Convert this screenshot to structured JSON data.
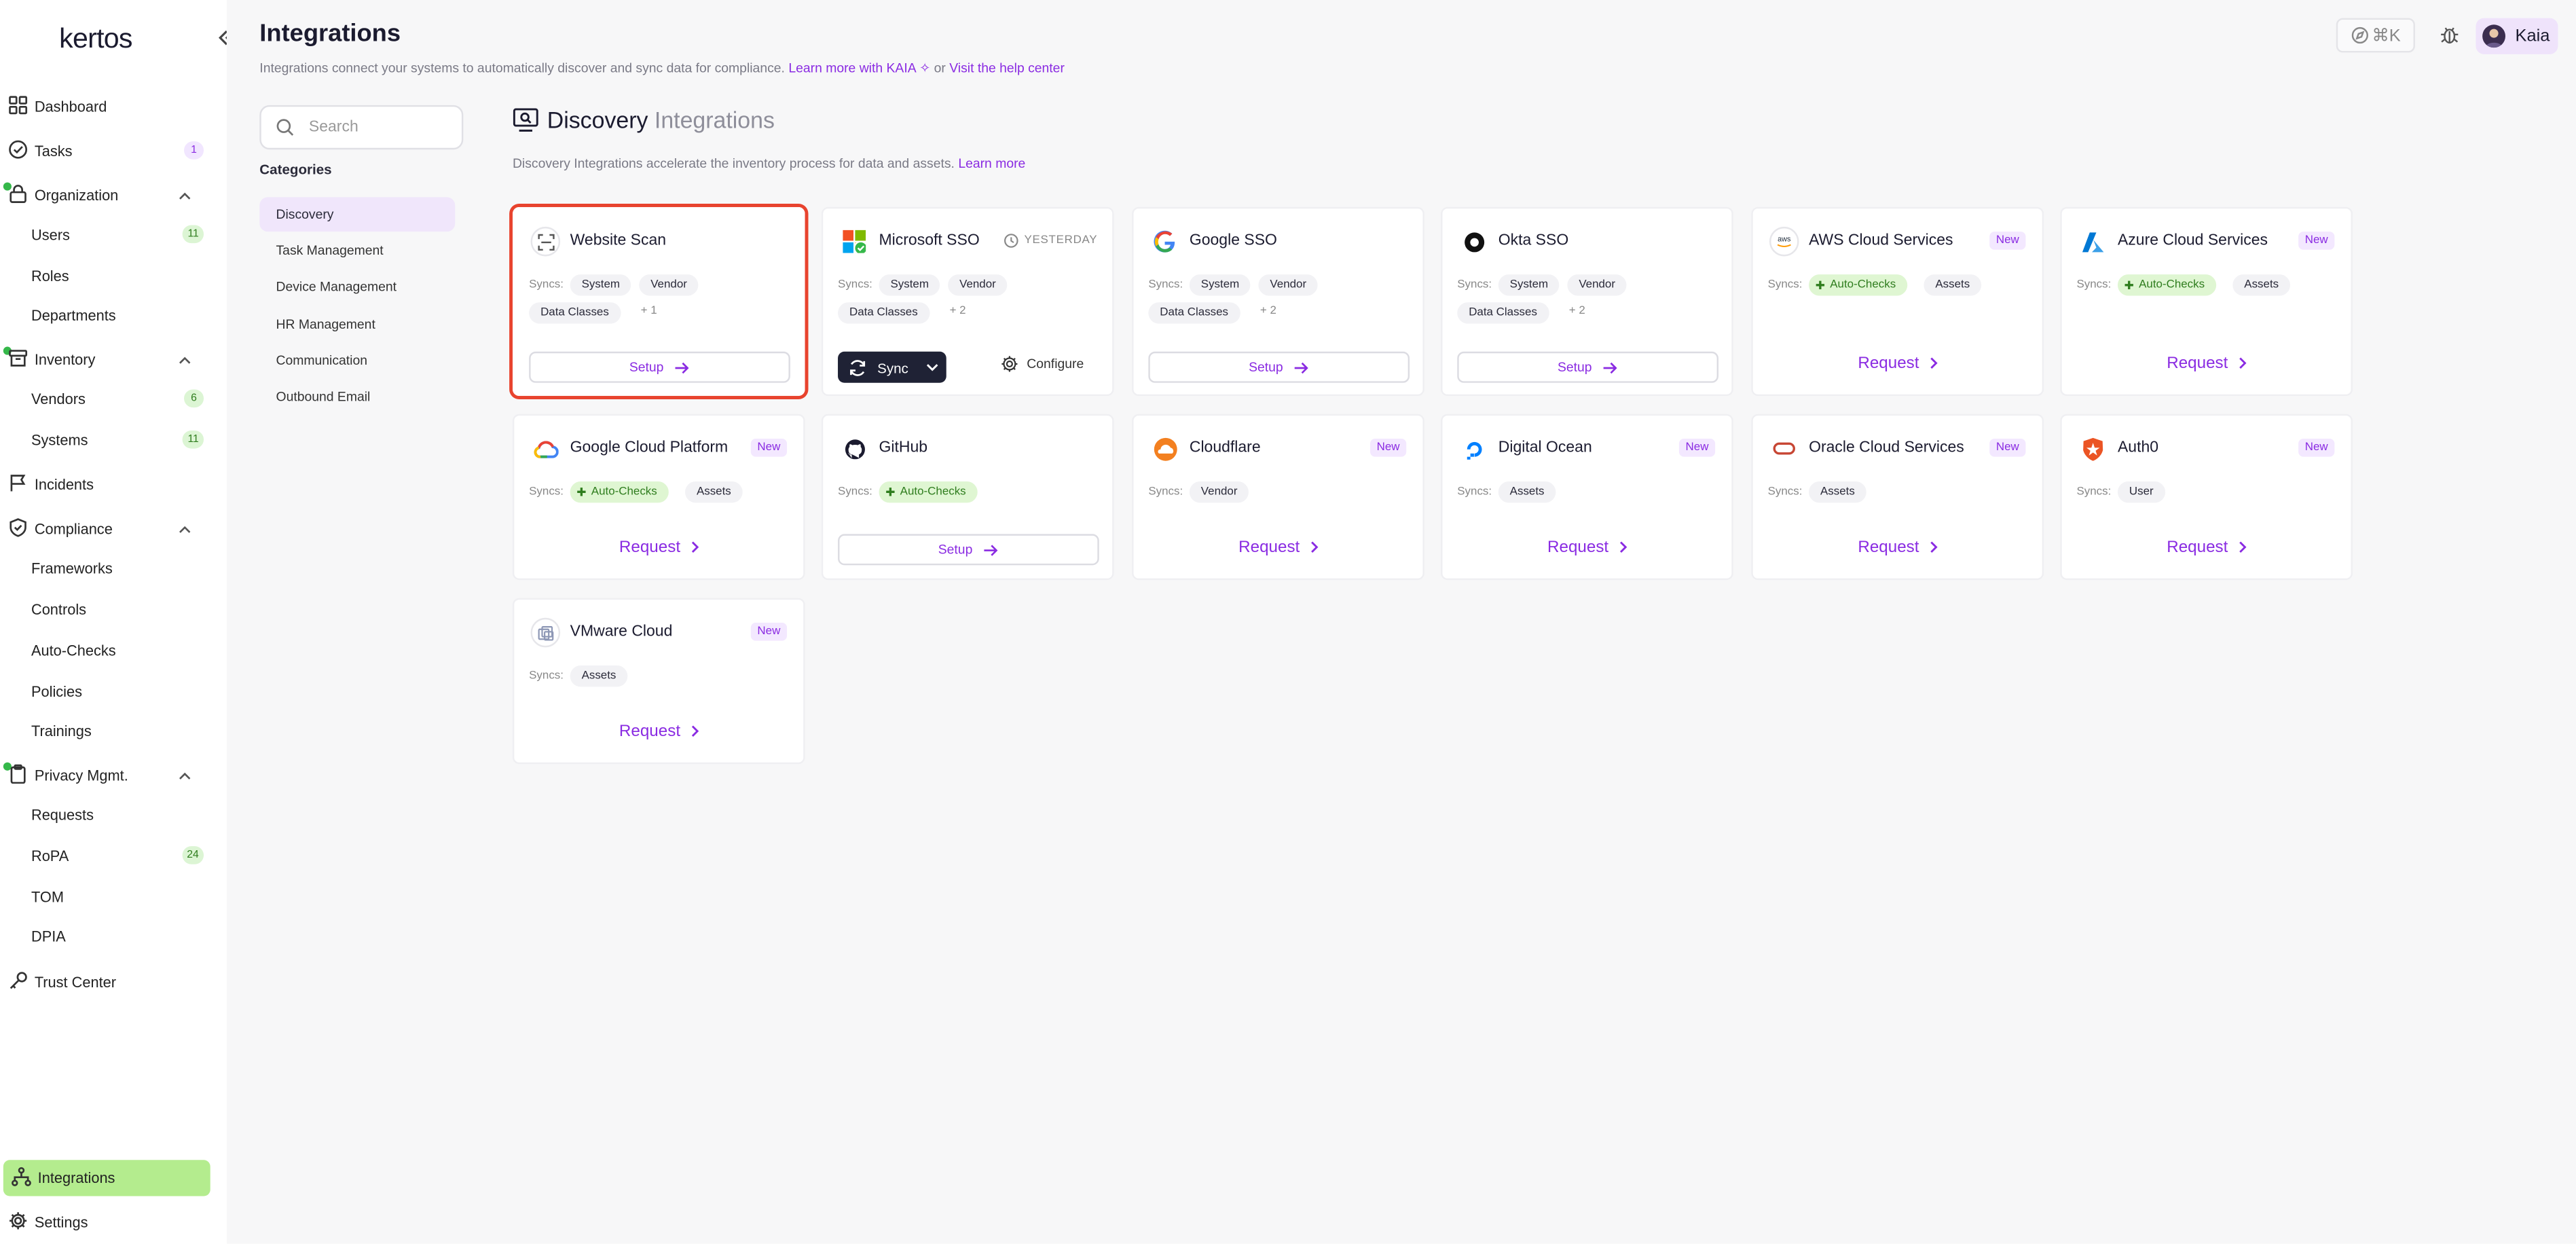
{
  "app": {
    "logo": "kertos"
  },
  "sidebar": {
    "items": [
      {
        "label": "Dashboard",
        "icon": "grid-icon"
      },
      {
        "label": "Tasks",
        "icon": "check-circle-icon",
        "badge": "1"
      },
      {
        "label": "Organization",
        "icon": "lock-icon"
      },
      {
        "label": "Users",
        "badge": "11"
      },
      {
        "label": "Roles"
      },
      {
        "label": "Departments"
      },
      {
        "label": "Inventory",
        "icon": "archive-icon"
      },
      {
        "label": "Vendors",
        "badge": "6"
      },
      {
        "label": "Systems",
        "badge": "11"
      },
      {
        "label": "Incidents",
        "icon": "flag-icon"
      },
      {
        "label": "Compliance",
        "icon": "shield-icon"
      },
      {
        "label": "Frameworks"
      },
      {
        "label": "Controls"
      },
      {
        "label": "Auto-Checks"
      },
      {
        "label": "Policies"
      },
      {
        "label": "Trainings"
      },
      {
        "label": "Privacy Mgmt.",
        "icon": "clipboard-icon"
      },
      {
        "label": "Requests"
      },
      {
        "label": "RoPA",
        "badge": "24"
      },
      {
        "label": "TOM"
      },
      {
        "label": "DPIA"
      },
      {
        "label": "Trust Center",
        "icon": "key-icon"
      },
      {
        "label": "Integrations",
        "icon": "integrations-icon",
        "active": true
      },
      {
        "label": "Settings",
        "icon": "gear-icon"
      }
    ]
  },
  "header": {
    "title": "Integrations",
    "subtitle": "Integrations connect your systems to automatically discover and sync data for compliance.",
    "learn_more": "Learn more with KAIA",
    "or": "or",
    "help": "Visit the help center",
    "shortcut": "⌘K",
    "user": "Kaia"
  },
  "filters": {
    "search_placeholder": "Search",
    "categories_title": "Categories",
    "categories": [
      "Discovery",
      "Task Management",
      "Device Management",
      "HR Management",
      "Communication",
      "Outbound Email"
    ]
  },
  "section": {
    "title": "Discovery",
    "title_muted": "Integrations",
    "description": "Discovery Integrations accelerate the inventory process for data and assets.",
    "learn_more": "Learn more"
  },
  "labels": {
    "syncs": "Syncs:",
    "setup": "Setup",
    "request": "Request",
    "sync": "Sync",
    "configure": "Configure",
    "new": "New",
    "yesterday": "YESTERDAY"
  },
  "cards": [
    {
      "name": "Website Scan",
      "tags": [
        "System",
        "Vendor",
        "Data Classes"
      ],
      "more": "+ 1",
      "action": "Setup",
      "selected": true
    },
    {
      "name": "Microsoft SSO",
      "tags": [
        "System",
        "Vendor",
        "Data Classes"
      ],
      "more": "+ 2",
      "action": "Sync",
      "status": "YESTERDAY"
    },
    {
      "name": "Google SSO",
      "tags": [
        "System",
        "Vendor",
        "Data Classes"
      ],
      "more": "+ 2",
      "action": "Setup"
    },
    {
      "name": "Okta SSO",
      "tags": [
        "System",
        "Vendor",
        "Data Classes"
      ],
      "more": "+ 2",
      "action": "Setup"
    },
    {
      "name": "AWS Cloud Services",
      "new": true,
      "tags": [
        "Auto-Checks",
        "Assets"
      ],
      "action": "Request"
    },
    {
      "name": "Azure Cloud Services",
      "new": true,
      "tags": [
        "Auto-Checks",
        "Assets"
      ],
      "action": "Request"
    },
    {
      "name": "Google Cloud Platform",
      "new": true,
      "tags": [
        "Auto-Checks",
        "Assets"
      ],
      "action": "Request"
    },
    {
      "name": "GitHub",
      "tags": [
        "Auto-Checks"
      ],
      "action": "Setup"
    },
    {
      "name": "Cloudflare",
      "new": true,
      "tags": [
        "Vendor"
      ],
      "action": "Request"
    },
    {
      "name": "Digital Ocean",
      "new": true,
      "tags": [
        "Assets"
      ],
      "action": "Request"
    },
    {
      "name": "Oracle Cloud Services",
      "new": true,
      "tags": [
        "Assets"
      ],
      "action": "Request"
    },
    {
      "name": "Auth0",
      "new": true,
      "tags": [
        "User"
      ],
      "action": "Request"
    },
    {
      "name": "VMware Cloud",
      "new": true,
      "tags": [
        "Assets"
      ],
      "action": "Request"
    }
  ],
  "colors": {
    "accent": "#8a2be2",
    "active_nav": "#b4ec8e",
    "selection": "#e8432e",
    "sync_button": "#1f2235"
  }
}
